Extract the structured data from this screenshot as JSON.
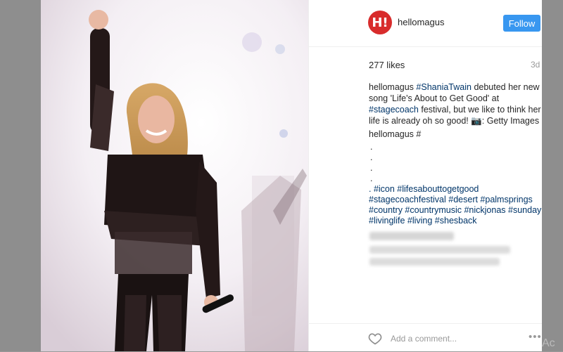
{
  "post": {
    "username": "hellomagus",
    "avatar_text": "H!",
    "follow_label": "Follow",
    "likes": "277 likes",
    "age": "3d"
  },
  "caption": {
    "user": "hellomagus",
    "tag1": "#ShaniaTwain",
    "text1": "debuted her new song 'Life's About to Get Good' at",
    "tag2": "#stagecoach",
    "text2": "festival, but we like to think her life is already oh so good! 📷: Getty Images"
  },
  "comment": {
    "user": "hellomagus",
    "suffix": "#",
    "dots": [
      ".",
      ".",
      ".",
      "."
    ],
    "hashtags": [
      ". #icon #lifesabouttogetgood",
      "#stagecoachfestival #desert #palmsprings",
      "#country #countrymusic #nickjonas #sunday",
      "#livinglife #living #shesback"
    ]
  },
  "footer": {
    "add_comment_placeholder": "Add a comment...",
    "more_label": "•••",
    "heart_icon": "heart-outline-icon"
  },
  "overlay": {
    "ac_text": "Ac"
  },
  "colors": {
    "follow_bg": "#3897f0",
    "hashtag": "#003569",
    "avatar_bg": "#d82c2c"
  }
}
